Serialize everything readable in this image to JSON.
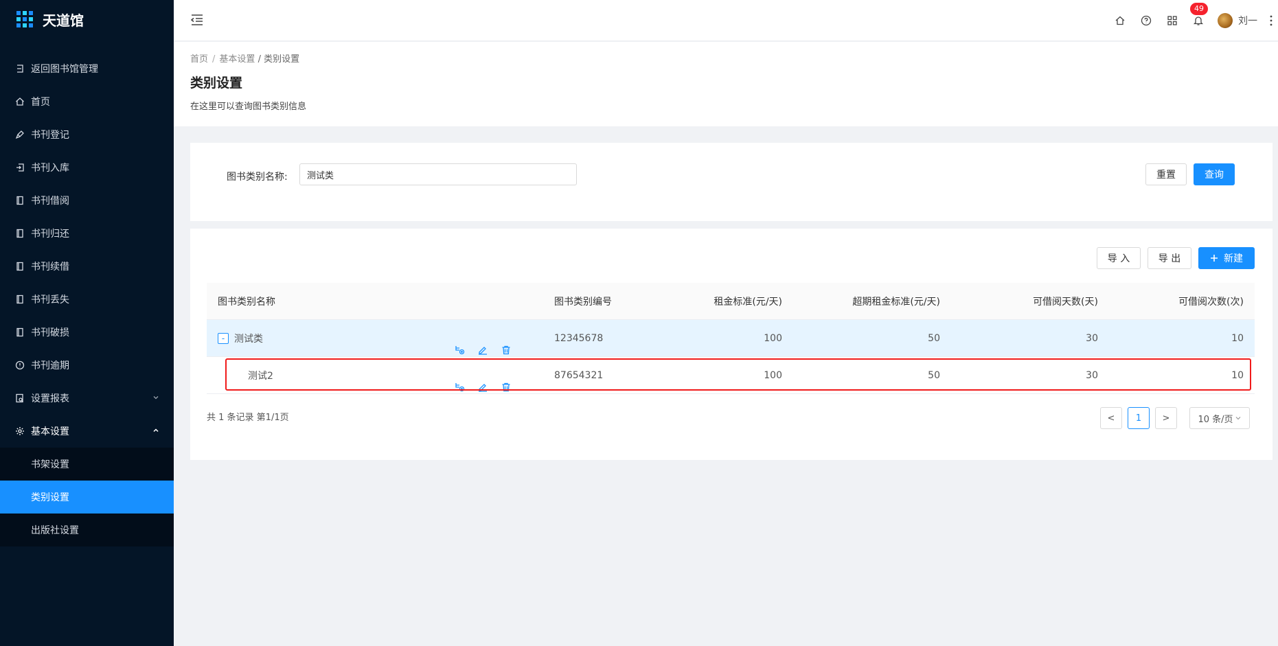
{
  "app": {
    "title": "天道馆"
  },
  "sidebar": {
    "items": [
      {
        "label": "返回图书馆管理",
        "icon": "return-icon"
      },
      {
        "label": "首页",
        "icon": "home-icon"
      },
      {
        "label": "书刊登记",
        "icon": "pen-icon"
      },
      {
        "label": "书刊入库",
        "icon": "login-icon"
      },
      {
        "label": "书刊借阅",
        "icon": "book-icon"
      },
      {
        "label": "书刊归还",
        "icon": "book-icon"
      },
      {
        "label": "书刊续借",
        "icon": "book-icon"
      },
      {
        "label": "书刊丢失",
        "icon": "book-icon"
      },
      {
        "label": "书刊破损",
        "icon": "book-icon"
      },
      {
        "label": "书刊逾期",
        "icon": "alert-circle-icon"
      },
      {
        "label": "设置报表",
        "icon": "report-icon"
      },
      {
        "label": "基本设置",
        "icon": "gear-icon"
      }
    ],
    "submenu": [
      {
        "label": "书架设置"
      },
      {
        "label": "类别设置"
      },
      {
        "label": "出版社设置"
      }
    ]
  },
  "header": {
    "notification_count": "49",
    "username": "刘一"
  },
  "breadcrumb": {
    "home": "首页",
    "sep": "/",
    "parent": "基本设置",
    "current": "/ 类别设置"
  },
  "page": {
    "title": "类别设置",
    "desc": "在这里可以查询图书类别信息"
  },
  "search": {
    "label": "图书类别名称:",
    "value": "测试类",
    "reset_label": "重置",
    "query_label": "查询"
  },
  "toolbar": {
    "import_label": "导 入",
    "export_label": "导 出",
    "new_label": "新建"
  },
  "table": {
    "columns": [
      "图书类别名称",
      "图书类别编号",
      "租金标准(元/天)",
      "超期租金标准(元/天)",
      "可借阅天数(天)",
      "可借阅次数(次)"
    ],
    "rows": [
      {
        "name": "测试类",
        "code": "12345678",
        "rent": "100",
        "overdue": "50",
        "days": "30",
        "times": "10"
      },
      {
        "name": "测试2",
        "code": "87654321",
        "rent": "100",
        "overdue": "50",
        "days": "30",
        "times": "10"
      }
    ],
    "expander": "-"
  },
  "pagination": {
    "total_text": "共 1 条记录 第1/1页",
    "prev": "<",
    "current": "1",
    "next": ">",
    "page_size": "10 条/页"
  },
  "colors": {
    "primary": "#1890ff",
    "sidebar_bg": "#041527",
    "highlight": "#f01b1b"
  }
}
